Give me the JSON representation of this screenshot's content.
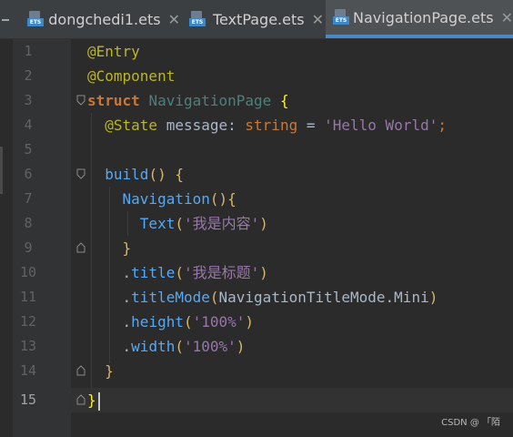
{
  "tabs": [
    {
      "label": "dongchedi1.ets",
      "icon": "ets-file-icon",
      "active": false
    },
    {
      "label": "TextPage.ets",
      "icon": "ets-file-icon",
      "active": false
    },
    {
      "label": "NavigationPage.ets",
      "icon": "ets-file-icon",
      "active": true
    }
  ],
  "close_glyph": "✕",
  "file_badge": "ETS",
  "line_numbers": [
    "1",
    "2",
    "3",
    "4",
    "5",
    "6",
    "7",
    "8",
    "9",
    "10",
    "11",
    "12",
    "13",
    "14",
    "15"
  ],
  "current_line": "15",
  "code": {
    "l1": "@Entry",
    "l2": "@Component",
    "l3_kw": "struct",
    "l3_name": "NavigationPage",
    "l3_brace": "{",
    "l4_ann": "@State",
    "l4_var": "message:",
    "l4_type": "string",
    "l4_eq": "=",
    "l4_str": "'Hello World'",
    "l4_semi": ";",
    "l5": "",
    "l6_fn": "build",
    "l6_paren": "()",
    "l6_brace": "{",
    "l7_fn": "Navigation",
    "l7_paren": "()",
    "l7_brace": "{",
    "l8_fn": "Text",
    "l8_po": "(",
    "l8_str": "'我是内容'",
    "l8_pc": ")",
    "l9": "}",
    "l10_dot": ".",
    "l10_fn": "title",
    "l10_po": "(",
    "l10_str": "'我是标题'",
    "l10_pc": ")",
    "l11_dot": ".",
    "l11_fn": "titleMode",
    "l11_po": "(",
    "l11_arg": "NavigationTitleMode.Mini",
    "l11_pc": ")",
    "l12_dot": ".",
    "l12_fn": "height",
    "l12_po": "(",
    "l12_str": "'100%'",
    "l12_pc": ")",
    "l13_dot": ".",
    "l13_fn": "width",
    "l13_po": "(",
    "l13_str": "'100%'",
    "l13_pc": ")",
    "l14": "}",
    "l15": "}"
  },
  "watermark": "CSDN @ 「陌"
}
